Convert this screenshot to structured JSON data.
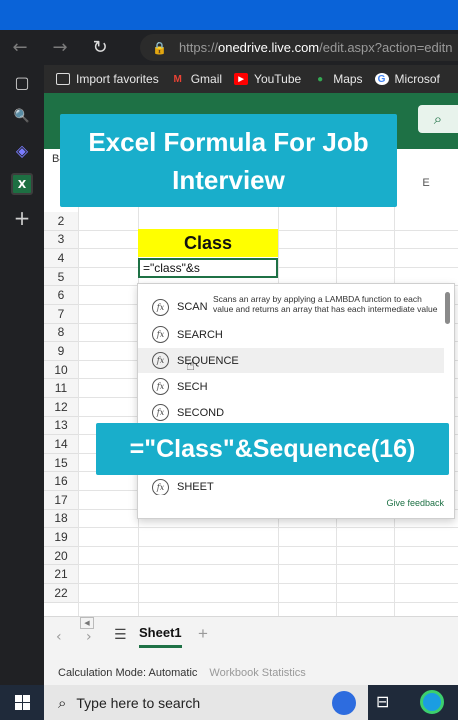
{
  "browser": {
    "url_scheme": "https://",
    "url_host": "onedrive.live.com",
    "url_path": "/edit.aspx?action=editn",
    "back_icon": "arrow-left-icon",
    "forward_icon": "arrow-right-icon",
    "refresh_icon": "refresh-icon",
    "lock_icon": "lock-icon"
  },
  "bookmarks": [
    {
      "label": "Import favorites",
      "icon": "import-icon",
      "color": "#dcdcdc"
    },
    {
      "label": "Gmail",
      "icon": "gmail-icon",
      "color": "#ea4335"
    },
    {
      "label": "YouTube",
      "icon": "youtube-icon",
      "color": "#ff0000"
    },
    {
      "label": "Maps",
      "icon": "maps-icon",
      "color": "#34a853"
    },
    {
      "label": "Microsof",
      "icon": "google-icon",
      "color": "#4285f4"
    }
  ],
  "sidebar": {
    "items": [
      "tabs-icon",
      "search-icon",
      "copilot-icon",
      "excel-icon",
      "add-icon"
    ],
    "excel_badge": "X"
  },
  "sheet": {
    "name_box": "B4",
    "column_e": "E",
    "rows": [
      "2",
      "3",
      "4",
      "5",
      "6",
      "7",
      "8",
      "9",
      "10",
      "11",
      "12",
      "13",
      "14",
      "15",
      "16",
      "17",
      "18",
      "19",
      "20",
      "21",
      "22"
    ],
    "class_cell": "Class",
    "edit_cell": "=\"class\"&s"
  },
  "autocomplete": {
    "items": [
      {
        "name": "SCAN",
        "desc": "Scans an array by applying a LAMBDA function to each value and returns an array that has each intermediate value"
      },
      {
        "name": "SEARCH",
        "desc": ""
      },
      {
        "name": "SEQUENCE",
        "desc": ""
      },
      {
        "name": "SECH",
        "desc": ""
      },
      {
        "name": "SECOND",
        "desc": ""
      },
      {
        "name": "SHEET",
        "desc": ""
      }
    ],
    "fx_label": "fx",
    "feedback": "Give feedback"
  },
  "overlay": {
    "title_line1": "Excel Formula For Job",
    "title_line2": "Interview",
    "formula": "=\"Class\"&Sequence(16)"
  },
  "tabs": {
    "sheet1": "Sheet1",
    "add": "+",
    "menu_icon": "menu-icon"
  },
  "status": {
    "calc_mode": "Calculation Mode: Automatic",
    "workbook_stats": "Workbook Statistics"
  },
  "taskbar": {
    "search_placeholder": "Type here to search",
    "windows_icon": "windows-icon",
    "task_view_icon": "task-view-icon",
    "edge_icon": "edge-icon"
  },
  "colors": {
    "excel_green": "#1e7145",
    "banner": "#19aecb",
    "highlight": "#ffff00"
  }
}
